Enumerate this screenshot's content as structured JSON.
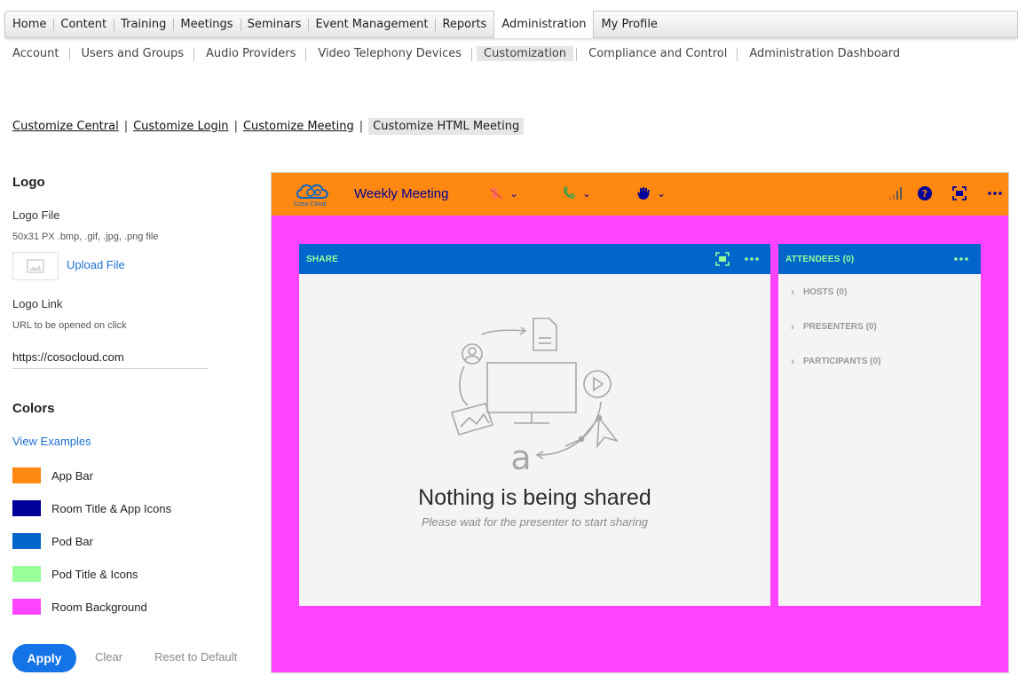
{
  "top_nav": {
    "items": [
      "Home",
      "Content",
      "Training",
      "Meetings",
      "Seminars",
      "Event Management",
      "Reports",
      "Administration",
      "My Profile"
    ],
    "active": "Administration"
  },
  "sub_nav": {
    "items": [
      "Account",
      "Users and Groups",
      "Audio Providers",
      "Video Telephony Devices",
      "Customization",
      "Compliance and Control",
      "Administration Dashboard"
    ],
    "active": "Customization"
  },
  "customize_links": {
    "items": [
      "Customize Central",
      "Customize Login",
      "Customize Meeting",
      "Customize HTML Meeting"
    ],
    "active": "Customize HTML Meeting"
  },
  "logo_section": {
    "heading": "Logo",
    "file_label": "Logo File",
    "file_hint": "50x31 PX .bmp, .gif, .jpg, .png file",
    "upload_label": "Upload File",
    "link_label": "Logo Link",
    "link_hint": "URL to be opened on click",
    "link_value": "https://cosocloud.com"
  },
  "colors_section": {
    "heading": "Colors",
    "examples_link": "View Examples",
    "swatches": [
      {
        "label": "App Bar",
        "color": "#FF8811"
      },
      {
        "label": "Room Title & App Icons",
        "color": "#000099"
      },
      {
        "label": "Pod Bar",
        "color": "#0066CC"
      },
      {
        "label": "Pod Title & Icons",
        "color": "#99FF99"
      },
      {
        "label": "Room Background",
        "color": "#FF44FF"
      }
    ]
  },
  "actions": {
    "apply": "Apply",
    "clear": "Clear",
    "reset": "Reset to Default"
  },
  "preview": {
    "logo_text": "Coso Cloud",
    "room_title": "Weekly Meeting",
    "share_pod": {
      "title": "SHARE",
      "heading": "Nothing is being shared",
      "subtext": "Please wait for the presenter to start sharing"
    },
    "attendees_pod": {
      "title": "ATTENDEES (0)",
      "groups": [
        "HOSTS (0)",
        "PRESENTERS (0)",
        "PARTICIPANTS (0)"
      ]
    }
  }
}
